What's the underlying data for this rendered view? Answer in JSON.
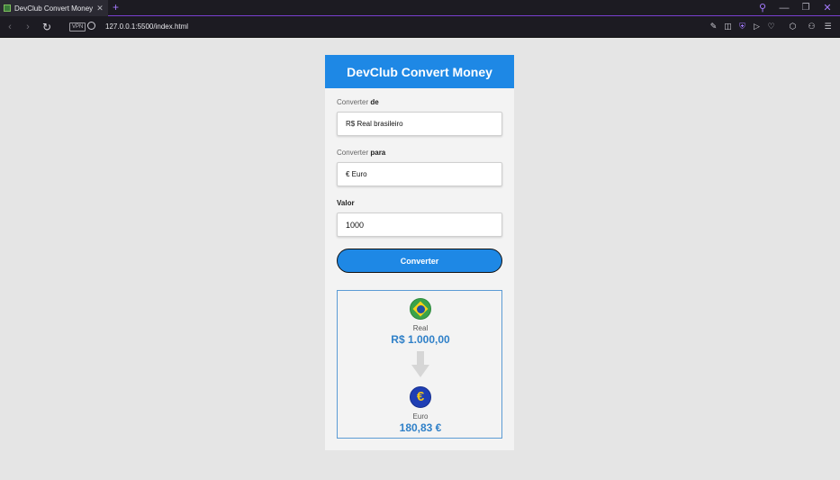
{
  "browser": {
    "tab_title": "DevClub Convert Money",
    "tab_close": "✕",
    "new_tab": "+",
    "url": "127.0.0.1:5500/index.html",
    "vpn_label": "VPN",
    "accent_color": "#7a3fd0"
  },
  "app": {
    "title": "DevClub Convert Money",
    "header_color": "#1e88e5",
    "from": {
      "label_prefix": "Converter ",
      "label_bold": "de",
      "selected": "R$ Real brasileiro"
    },
    "to": {
      "label_prefix": "Converter ",
      "label_bold": "para",
      "selected": "€ Euro"
    },
    "amount": {
      "label": "Valor",
      "value": "1000"
    },
    "convert_button": "Converter",
    "result": {
      "from_currency_name": "Real",
      "from_currency_value": "R$ 1.000,00",
      "to_currency_name": "Euro",
      "to_currency_value": "180,83 €",
      "euro_symbol": "€"
    }
  }
}
